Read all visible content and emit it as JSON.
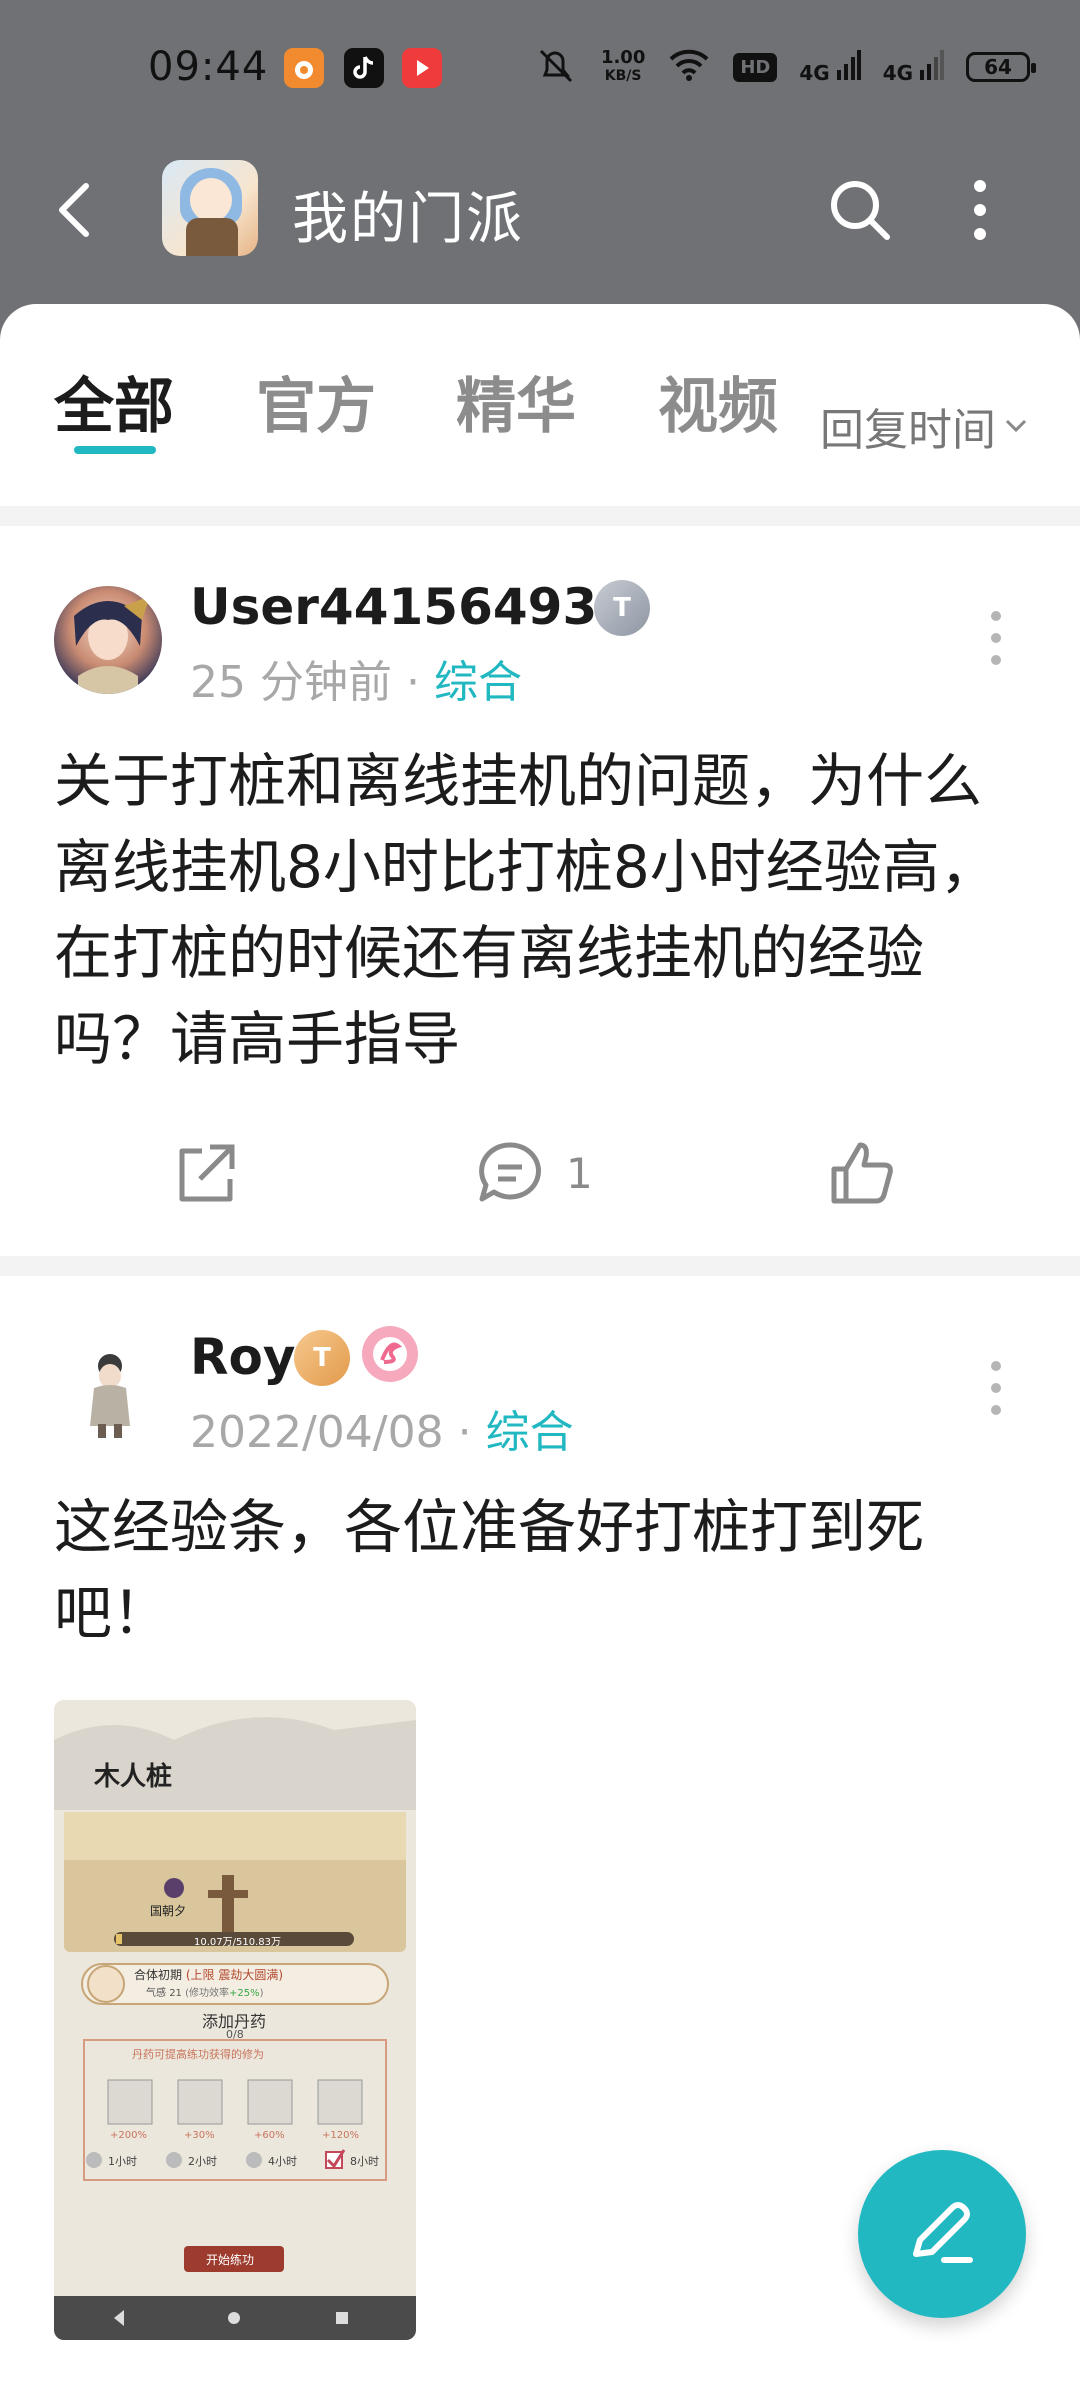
{
  "status_bar": {
    "time": "09:44",
    "speed_value": "1.00",
    "speed_unit": "KB/S",
    "hd_label": "HD",
    "signal1": "4G",
    "signal2": "4G",
    "battery": "64",
    "app_icons": [
      "uc-browser-icon",
      "tiktok-icon",
      "video-app-icon"
    ]
  },
  "toolbar": {
    "title": "我的门派"
  },
  "tabs": [
    {
      "label": "全部",
      "active": true
    },
    {
      "label": "官方",
      "active": false
    },
    {
      "label": "精华",
      "active": false
    },
    {
      "label": "视频",
      "active": false
    }
  ],
  "sort": {
    "label": "回复时间"
  },
  "posts": [
    {
      "author": "User441564935",
      "badge": "T",
      "time": "25 分钟前",
      "separator": "·",
      "category": "综合",
      "body": "关于打桩和离线挂机的问题，为什么离线挂机8小时比打桩8小时经验高，在打桩的时候还有离线挂机的经验吗？请高手指导",
      "comments": "1"
    },
    {
      "author": "Roy",
      "badge": "T",
      "time": "2022/04/08",
      "separator": "·",
      "category": "综合",
      "body": "这经验条，各位准备好打桩打到死吧！",
      "image": {
        "scene_title": "木人桩",
        "char_name": "国朝夕",
        "exp": "10.07万/510.83万",
        "realm": "合体初期",
        "realm_note": "(上限 震劫大圆满)",
        "qi": "气感",
        "qi_val": "21",
        "eff_note": "(修功效率",
        "eff_val": "+25%",
        "eff_close": ")",
        "add_pill": "添加丹药",
        "pill_count": "0/8",
        "pill_hint": "丹药可提高练功获得的修为",
        "pill_bonus": [
          "+200%",
          "+30%",
          "+60%",
          "+120%"
        ],
        "hours": [
          "1小时",
          "2小时",
          "4小时",
          "8小时"
        ],
        "start_btn": "开始练功"
      }
    }
  ],
  "colors": {
    "accent": "#22b8c1",
    "header": "#6f7174"
  }
}
